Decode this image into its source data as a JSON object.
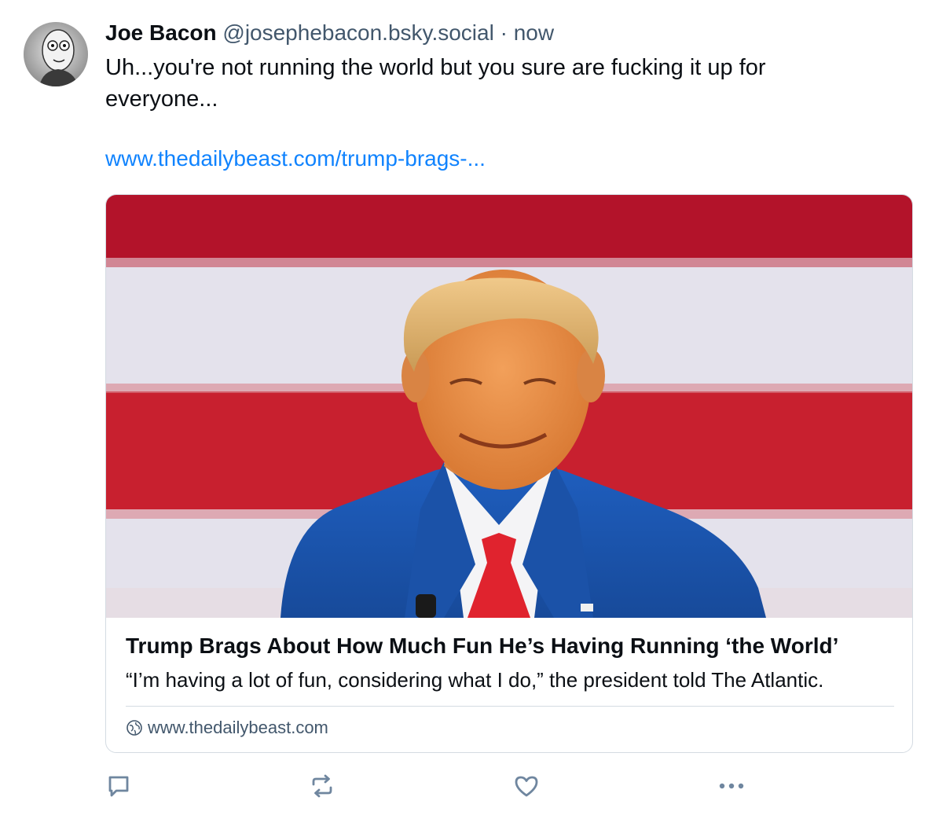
{
  "post": {
    "author": {
      "display_name": "Joe Bacon",
      "handle": "@josephebacon.bsky.social",
      "separator": "·",
      "timestamp": "now",
      "avatar_icon": "user-avatar-icon"
    },
    "text": "Uh...you're not running the world but you sure are fucking it up for everyone...",
    "link_text": "www.thedailybeast.com/trump-brags-...",
    "embed": {
      "title": "Trump Brags About How Much Fun He’s Having Running ‘the World’",
      "description": "“I’m having a lot of fun, considering what I do,” the president told The Atlantic.",
      "domain": "www.thedailybeast.com",
      "domain_icon": "globe-icon"
    },
    "actions": [
      {
        "name": "reply",
        "icon": "comment-icon"
      },
      {
        "name": "repost",
        "icon": "repost-icon"
      },
      {
        "name": "like",
        "icon": "heart-icon"
      },
      {
        "name": "more",
        "icon": "more-icon"
      }
    ]
  },
  "colors": {
    "link": "#1083fe",
    "secondary_text": "#42576c",
    "border": "#d4dbe2",
    "icon": "#6f869f"
  }
}
